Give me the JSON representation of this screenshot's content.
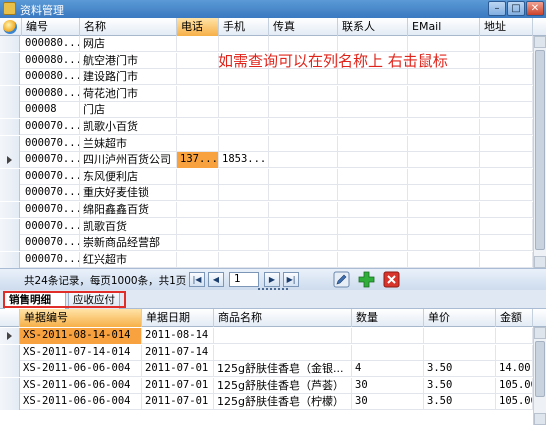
{
  "window": {
    "title": "资料管理",
    "min_label": "–",
    "max_label": "□",
    "close_label": "✕"
  },
  "top_grid": {
    "columns": [
      "编号",
      "名称",
      "电话",
      "手机",
      "传真",
      "联系人",
      "EMail",
      "地址"
    ],
    "rows": [
      [
        "000080...",
        "网店",
        "",
        "",
        "",
        "",
        "",
        ""
      ],
      [
        "000080...",
        "航空港门市",
        "",
        "",
        "",
        "",
        "",
        ""
      ],
      [
        "000080...",
        "建设路门市",
        "",
        "",
        "",
        "",
        "",
        ""
      ],
      [
        "000080...",
        "荷花池门市",
        "",
        "",
        "",
        "",
        "",
        ""
      ],
      [
        "00008",
        "门店",
        "",
        "",
        "",
        "",
        "",
        ""
      ],
      [
        "000070...",
        "凯歌小百货",
        "",
        "",
        "",
        "",
        "",
        ""
      ],
      [
        "000070...",
        "兰妹超市",
        "",
        "",
        "",
        "",
        "",
        ""
      ],
      [
        "000070...",
        "四川泸州百货公司",
        "137...",
        "1853...",
        "",
        "",
        "",
        ""
      ],
      [
        "000070...",
        "东风便利店",
        "",
        "",
        "",
        "",
        "",
        ""
      ],
      [
        "000070...",
        "重庆好麦佳锁",
        "",
        "",
        "",
        "",
        "",
        ""
      ],
      [
        "000070...",
        "绵阳鑫鑫百货",
        "",
        "",
        "",
        "",
        "",
        ""
      ],
      [
        "000070...",
        "凯歌百货",
        "",
        "",
        "",
        "",
        "",
        ""
      ],
      [
        "000070...",
        "崇新商品经营部",
        "",
        "",
        "",
        "",
        "",
        ""
      ],
      [
        "000070...",
        "红兴超市",
        "",
        "",
        "",
        "",
        "",
        ""
      ]
    ]
  },
  "annotation": "如需查询可以在列名称上 右击鼠标",
  "pager": {
    "info": "共24条记录，每页1000条，共1页",
    "first": "|◀",
    "prev": "◀",
    "page": "1",
    "next": "▶",
    "last": "▶|"
  },
  "tabs": [
    "销售明细历史",
    "应收应付"
  ],
  "bottom_grid": {
    "columns": [
      "单据编号",
      "单据日期",
      "商品名称",
      "数量",
      "单价",
      "金额"
    ],
    "rows": [
      [
        "XS-2011-08-14-014",
        "2011-08-14",
        "",
        "",
        "",
        ""
      ],
      [
        "XS-2011-07-14-014",
        "2011-07-14",
        "",
        "",
        "",
        ""
      ],
      [
        "XS-2011-06-06-004",
        "2011-07-01",
        "125g舒肤佳香皂（金银...",
        "4",
        "3.50",
        "14.00"
      ],
      [
        "XS-2011-06-06-004",
        "2011-07-01",
        "125g舒肤佳香皂（芦荟）",
        "30",
        "3.50",
        "105.00"
      ],
      [
        "XS-2011-06-06-004",
        "2011-07-01",
        "125g舒肤佳香皂（柠檬）",
        "30",
        "3.50",
        "105.00"
      ]
    ]
  },
  "colors": {
    "accent_orange": "#f7a23e",
    "annotation_red": "#e0241b",
    "title_blue": "#3a78c0"
  }
}
